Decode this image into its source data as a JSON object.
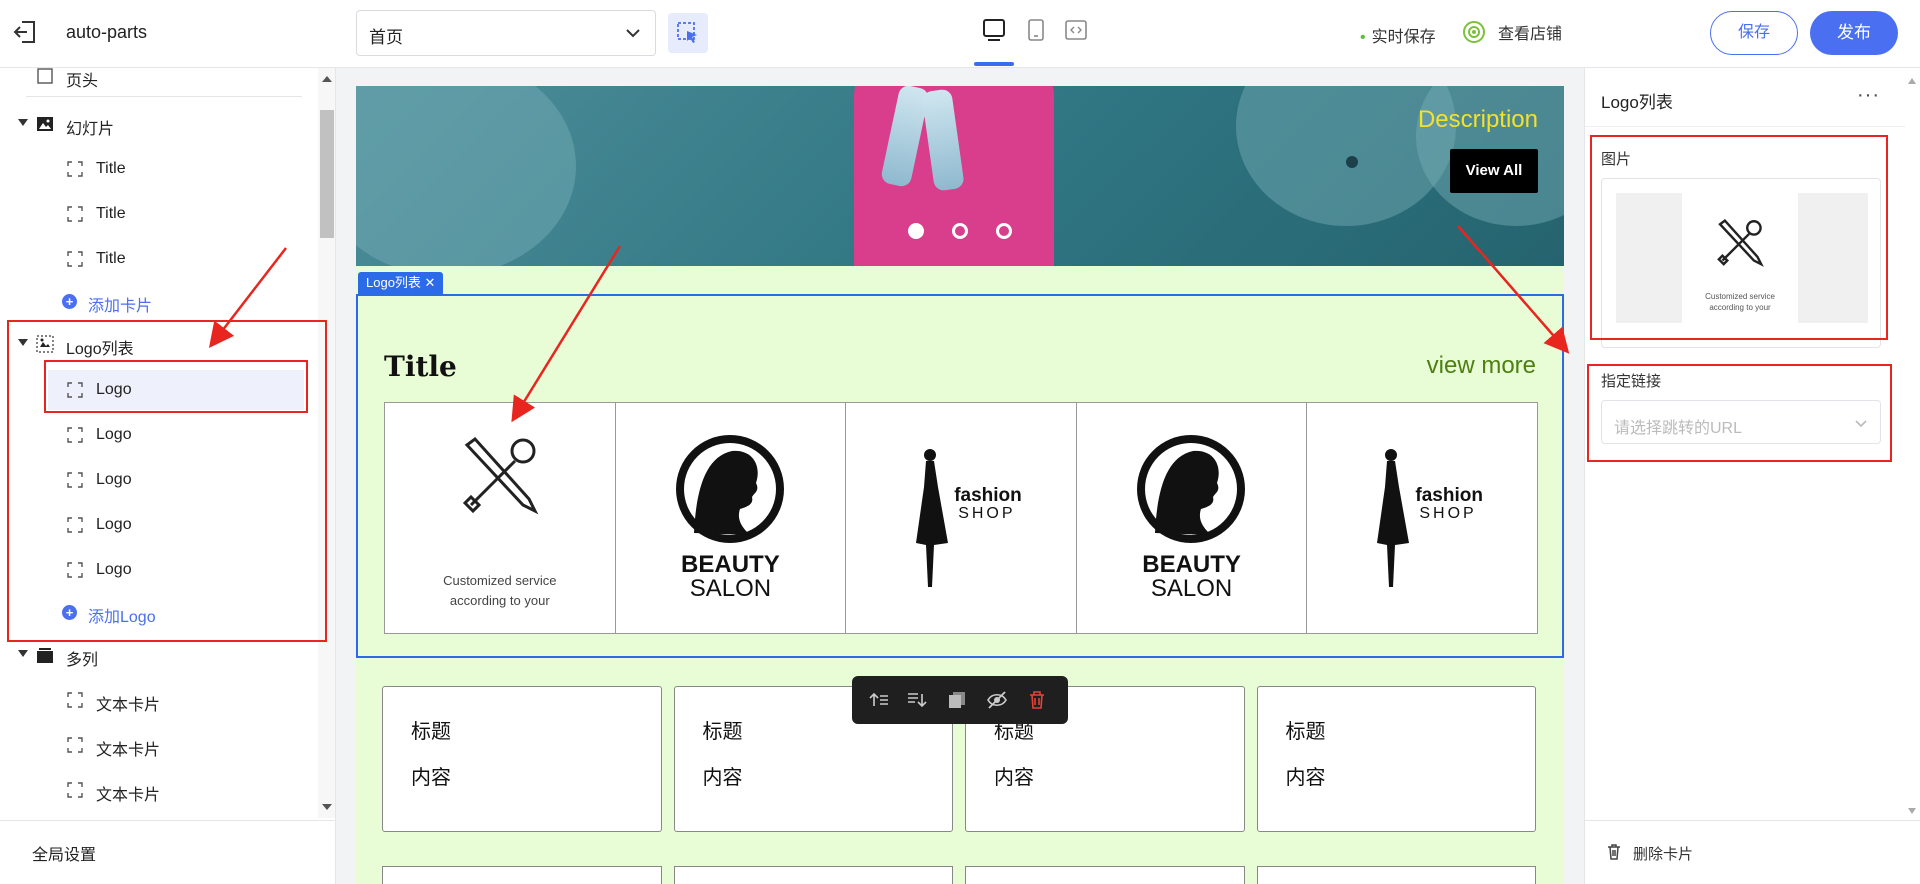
{
  "topbar": {
    "app_name": "auto-parts",
    "page_select_value": "首页",
    "autosave": "实时保存",
    "view_store": "查看店铺",
    "save": "保存",
    "publish": "发布"
  },
  "tree": {
    "partial_top": "页头",
    "slideshow": {
      "label": "幻灯片",
      "items": [
        "Title",
        "Title",
        "Title"
      ],
      "add": "添加卡片"
    },
    "logo_list": {
      "label": "Logo列表",
      "items": [
        "Logo",
        "Logo",
        "Logo",
        "Logo",
        "Logo"
      ],
      "add": "添加Logo"
    },
    "multi_col": {
      "label": "多列",
      "items": [
        "文本卡片",
        "文本卡片",
        "文本卡片"
      ]
    },
    "global_settings": "全局设置"
  },
  "canvas": {
    "hero": {
      "description": "Description",
      "button": "View All",
      "slide_count": 3,
      "active_slide": 1
    },
    "logo_tag": "Logo列表",
    "logo_section": {
      "title": "Title",
      "view_more": "view more",
      "logos": [
        {
          "type": "tools",
          "caption_1": "Customized service",
          "caption_2": "according to your"
        },
        {
          "type": "beauty",
          "line_1": "BEAUTY",
          "line_2": "SALON"
        },
        {
          "type": "fashion",
          "line_1": "fashion",
          "line_2": "SHOP"
        },
        {
          "type": "beauty",
          "line_1": "BEAUTY",
          "line_2": "SALON"
        },
        {
          "type": "fashion",
          "line_1": "fashion",
          "line_2": "SHOP"
        }
      ]
    },
    "cards": [
      {
        "title": "标题",
        "content": "内容"
      },
      {
        "title": "标题",
        "content": "内容"
      },
      {
        "title": "标题",
        "content": "内容"
      },
      {
        "title": "标题",
        "content": "内容"
      }
    ]
  },
  "right_panel": {
    "title": "Logo列表",
    "more": "···",
    "image_label": "图片",
    "image_caption_1": "Customized service",
    "image_caption_2": "according to your",
    "link_label": "指定链接",
    "link_placeholder": "请选择跳转的URL",
    "delete_card": "删除卡片"
  },
  "colors": {
    "accent": "#4a6ff0",
    "selection": "#2c6be8",
    "canvas_bg": "#e8fcd6",
    "annotation": "#e8261f",
    "hero_text": "#f3e12a"
  }
}
